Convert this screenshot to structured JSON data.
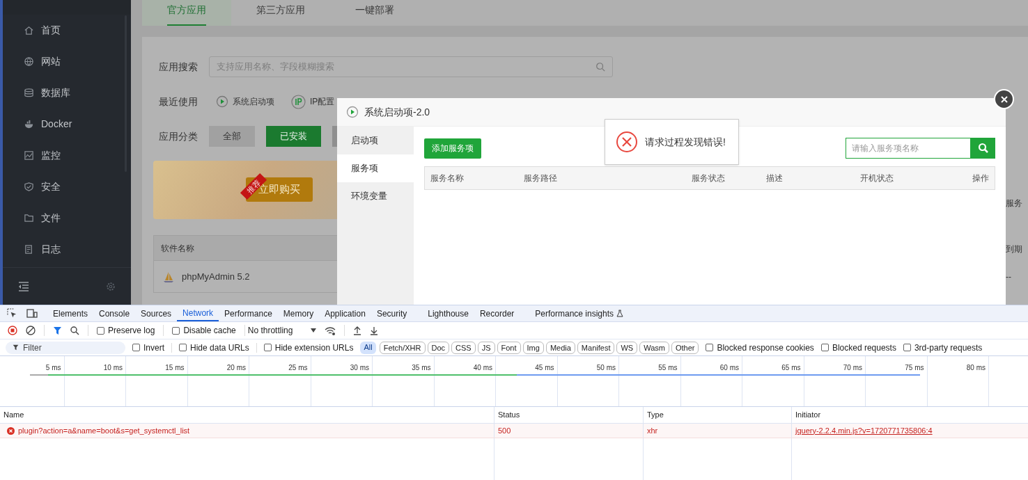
{
  "sidebar": {
    "items": [
      {
        "label": "首页"
      },
      {
        "label": "网站"
      },
      {
        "label": "数据库"
      },
      {
        "label": "Docker"
      },
      {
        "label": "监控"
      },
      {
        "label": "安全"
      },
      {
        "label": "文件"
      },
      {
        "label": "日志"
      }
    ]
  },
  "app_tabs": [
    {
      "label": "官方应用",
      "selected": true
    },
    {
      "label": "第三方应用",
      "selected": false
    },
    {
      "label": "一键部署",
      "selected": false
    }
  ],
  "search": {
    "label": "应用搜索",
    "placeholder": "支持应用名称、字段模糊搜索"
  },
  "recent": {
    "label": "最近使用",
    "items": [
      {
        "label": "系统启动项"
      },
      {
        "label": "IP配置"
      }
    ]
  },
  "category": {
    "label": "应用分类",
    "buttons": [
      {
        "label": "全部",
        "selected": false
      },
      {
        "label": "已安装",
        "selected": true
      }
    ]
  },
  "banner": {
    "ribbon": "推荐",
    "button": "立即购买",
    "side_text": "服务"
  },
  "app_table": {
    "columns": [
      "软件名称",
      "到期"
    ],
    "rows": [
      {
        "name": "phpMyAdmin 5.2",
        "expiry": "--"
      }
    ]
  },
  "modal": {
    "title": "系统启动项-2.0",
    "nav": [
      {
        "label": "启动项",
        "selected": false
      },
      {
        "label": "服务项",
        "selected": true
      },
      {
        "label": "环境变量",
        "selected": false
      }
    ],
    "add_button": "添加服务项",
    "search_placeholder": "请输入服务项名称",
    "columns": [
      "服务名称",
      "服务路径",
      "服务状态",
      "描述",
      "开机状态",
      "操作"
    ]
  },
  "toast": {
    "message": "请求过程发现错误!"
  },
  "devtools": {
    "tabs": [
      {
        "label": "Elements",
        "selected": false
      },
      {
        "label": "Console",
        "selected": false
      },
      {
        "label": "Sources",
        "selected": false
      },
      {
        "label": "Network",
        "selected": true
      },
      {
        "label": "Performance",
        "selected": false
      },
      {
        "label": "Memory",
        "selected": false
      },
      {
        "label": "Application",
        "selected": false
      },
      {
        "label": "Security",
        "selected": false
      },
      {
        "label": "Lighthouse",
        "selected": false
      },
      {
        "label": "Recorder",
        "selected": false
      },
      {
        "label": "Performance insights",
        "selected": false
      }
    ],
    "toolbar": {
      "checkboxes": [
        {
          "label": "Preserve log",
          "checked": false
        },
        {
          "label": "Disable cache",
          "checked": false
        }
      ],
      "throttling": "No throttling"
    },
    "filter": {
      "placeholder": "Filter",
      "options_left": [
        {
          "label": "Invert",
          "checked": false
        },
        {
          "label": "Hide data URLs",
          "checked": false
        },
        {
          "label": "Hide extension URLs",
          "checked": false
        }
      ],
      "types": [
        {
          "label": "All",
          "selected": true
        },
        {
          "label": "Fetch/XHR",
          "selected": false
        },
        {
          "label": "Doc",
          "selected": false
        },
        {
          "label": "CSS",
          "selected": false
        },
        {
          "label": "JS",
          "selected": false
        },
        {
          "label": "Font",
          "selected": false
        },
        {
          "label": "Img",
          "selected": false
        },
        {
          "label": "Media",
          "selected": false
        },
        {
          "label": "Manifest",
          "selected": false
        },
        {
          "label": "WS",
          "selected": false
        },
        {
          "label": "Wasm",
          "selected": false
        },
        {
          "label": "Other",
          "selected": false
        }
      ],
      "options_right": [
        {
          "label": "Blocked response cookies",
          "checked": false
        },
        {
          "label": "Blocked requests",
          "checked": false
        },
        {
          "label": "3rd-party requests",
          "checked": false
        }
      ]
    },
    "timeline_ticks": [
      "5 ms",
      "10 ms",
      "15 ms",
      "20 ms",
      "25 ms",
      "30 ms",
      "35 ms",
      "40 ms",
      "45 ms",
      "50 ms",
      "55 ms",
      "60 ms",
      "65 ms",
      "70 ms",
      "75 ms",
      "80 ms"
    ],
    "columns": [
      "Name",
      "Status",
      "Type",
      "Initiator"
    ],
    "requests": [
      {
        "name": "plugin?action=a&name=boot&s=get_systemctl_list",
        "status": "500",
        "type": "xhr",
        "initiator": "jquery-2.2.4.min.js?v=1720771735806:4",
        "failed": true
      }
    ]
  }
}
